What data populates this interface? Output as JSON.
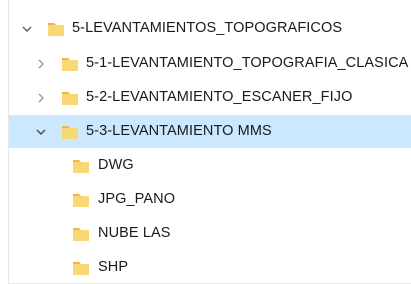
{
  "tree": {
    "root": {
      "label": "5-LEVANTAMIENTOS_TOPOGRAFICOS",
      "expanded": true,
      "chevron_icon": "chevron-down-icon",
      "folder_icon": "folder-icon"
    },
    "children": [
      {
        "label": "5-1-LEVANTAMIENTO_TOPOGRAFIA_CLASICA",
        "expanded": false,
        "selected": false,
        "chevron_icon": "chevron-right-icon"
      },
      {
        "label": "5-2-LEVANTAMIENTO_ESCANER_FIJO",
        "expanded": false,
        "selected": false,
        "chevron_icon": "chevron-right-icon"
      },
      {
        "label": "5-3-LEVANTAMIENTO MMS",
        "expanded": true,
        "selected": true,
        "chevron_icon": "chevron-down-icon"
      }
    ],
    "grandchildren": [
      {
        "label": "DWG"
      },
      {
        "label": "JPG_PANO"
      },
      {
        "label": "NUBE LAS"
      },
      {
        "label": "SHP"
      }
    ]
  },
  "colors": {
    "folder_fill": "#f8d775",
    "folder_back": "#e8b94a",
    "selected_bg": "#cce8ff",
    "chevron": "#5a5a5a",
    "text": "#1a1a1a"
  }
}
